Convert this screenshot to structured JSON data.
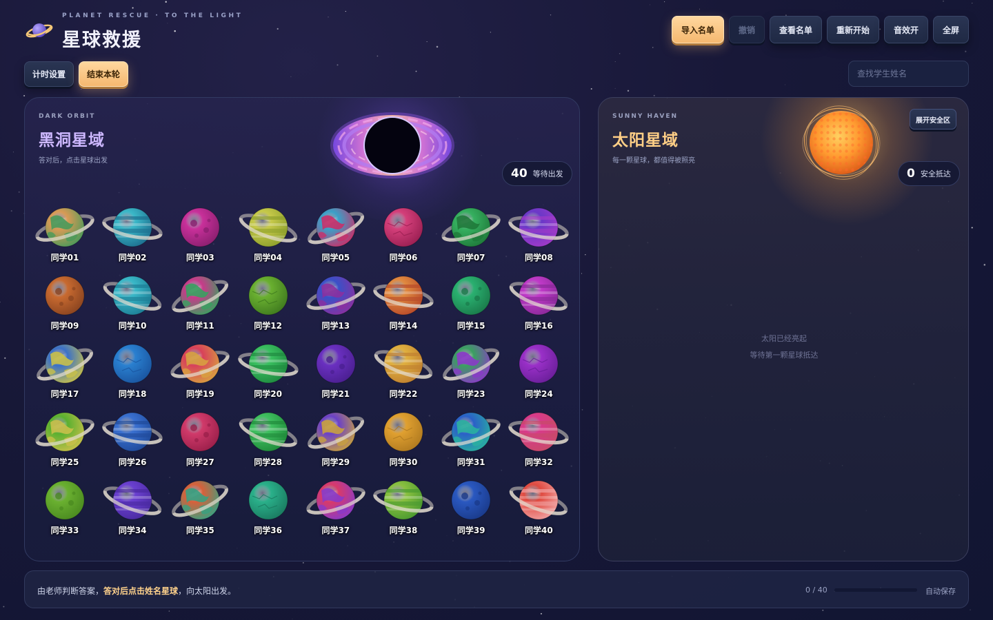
{
  "header": {
    "subtitle": "PLANET RESCUE · TO THE LIGHT",
    "title": "星球救援",
    "logo_icon": "ringed-planet-icon"
  },
  "toolbar": {
    "import_label": "导入名单",
    "undo_label": "撤销",
    "view_list_label": "查看名单",
    "restart_label": "重新开始",
    "sound_label": "音效开",
    "fullscreen_label": "全屏",
    "timer_label": "计时设置",
    "end_round_label": "结束本轮"
  },
  "search": {
    "placeholder": "查找学生姓名",
    "value": ""
  },
  "dark_zone": {
    "label_en": "DARK ORBIT",
    "title": "黑洞星域",
    "desc": "答对后，点击星球出发",
    "count": "40",
    "count_label": "等待出发",
    "icon": "black-hole-icon"
  },
  "sun_zone": {
    "label_en": "SUNNY HAVEN",
    "title": "太阳星域",
    "desc": "每一颗星球，都值得被照亮",
    "count": "0",
    "count_label": "安全抵达",
    "expand_label": "展开安全区",
    "empty_line1": "太阳已经亮起",
    "empty_line2": "等待第一颗星球抵达",
    "icon": "sun-icon"
  },
  "footer": {
    "msg_before": "由老师判断答案，",
    "msg_highlight": "答对后点击姓名星球",
    "msg_after": "，向太阳出发。",
    "progress_text": "0 / 40",
    "progress_value": 0,
    "autosave": "自动保存"
  },
  "colors": {
    "accent_gold": "#ffcf86",
    "accent_purple": "#cdb8ff",
    "background": "#181838"
  },
  "planets": [
    {
      "name": "同学01",
      "c1": "#d99a55",
      "c2": "#4a9a5a",
      "ring": true,
      "style": "patch"
    },
    {
      "name": "同学02",
      "c1": "#3bb8c8",
      "c2": "#1d6f8f",
      "ring": true,
      "style": "band"
    },
    {
      "name": "同学03",
      "c1": "#c8309a",
      "c2": "#8a1f6f",
      "ring": false,
      "style": "crater"
    },
    {
      "name": "同学04",
      "c1": "#c6c94a",
      "c2": "#8ea02c",
      "ring": true,
      "style": "band"
    },
    {
      "name": "同学05",
      "c1": "#3aa0c8",
      "c2": "#c8306a",
      "ring": true,
      "style": "patch"
    },
    {
      "name": "同学06",
      "c1": "#d43f7a",
      "c2": "#9a1f52",
      "ring": false,
      "style": "crack"
    },
    {
      "name": "同学07",
      "c1": "#36b060",
      "c2": "#1f7a3a",
      "ring": true,
      "style": "patch"
    },
    {
      "name": "同学08",
      "c1": "#6a38c8",
      "c2": "#a03ac8",
      "ring": true,
      "style": "band"
    },
    {
      "name": "同学09",
      "c1": "#c86a30",
      "c2": "#8a4420",
      "ring": false,
      "style": "crater"
    },
    {
      "name": "同学10",
      "c1": "#3ab8c8",
      "c2": "#1d7d95",
      "ring": true,
      "style": "band"
    },
    {
      "name": "同学11",
      "c1": "#c83a8a",
      "c2": "#3aa060",
      "ring": true,
      "style": "patch"
    },
    {
      "name": "同学12",
      "c1": "#6ab030",
      "c2": "#3f7a1f",
      "ring": false,
      "style": "crack"
    },
    {
      "name": "同学13",
      "c1": "#3a50c8",
      "c2": "#8a30a0",
      "ring": true,
      "style": "patch"
    },
    {
      "name": "同学14",
      "c1": "#e08a40",
      "c2": "#b84a2a",
      "ring": true,
      "style": "band"
    },
    {
      "name": "同学15",
      "c1": "#2ab070",
      "c2": "#1a7a4a",
      "ring": false,
      "style": "crater"
    },
    {
      "name": "同学16",
      "c1": "#c03ac8",
      "c2": "#8a2a9a",
      "ring": true,
      "style": "band"
    },
    {
      "name": "同学17",
      "c1": "#3a70c8",
      "c2": "#c8c04a",
      "ring": true,
      "style": "patch"
    },
    {
      "name": "同学18",
      "c1": "#2a80d0",
      "c2": "#1a55a0",
      "ring": false,
      "style": "crack"
    },
    {
      "name": "同学19",
      "c1": "#d8405a",
      "c2": "#d8a040",
      "ring": true,
      "style": "patch"
    },
    {
      "name": "同学20",
      "c1": "#3ac060",
      "c2": "#1f8a40",
      "ring": true,
      "style": "band"
    },
    {
      "name": "同学21",
      "c1": "#6a30c0",
      "c2": "#4a1f90",
      "ring": false,
      "style": "crater"
    },
    {
      "name": "同学22",
      "c1": "#e0b040",
      "c2": "#c08030",
      "ring": true,
      "style": "band"
    },
    {
      "name": "同学23",
      "c1": "#3aa060",
      "c2": "#8a3ac8",
      "ring": true,
      "style": "patch"
    },
    {
      "name": "同学24",
      "c1": "#9a30c8",
      "c2": "#6a1f9a",
      "ring": false,
      "style": "crack"
    },
    {
      "name": "同学25",
      "c1": "#5ab030",
      "c2": "#c8c04a",
      "ring": true,
      "style": "patch"
    },
    {
      "name": "同学26",
      "c1": "#3a70d0",
      "c2": "#1f4a9a",
      "ring": true,
      "style": "band"
    },
    {
      "name": "同学27",
      "c1": "#d03a6a",
      "c2": "#9a1f4a",
      "ring": false,
      "style": "crater"
    },
    {
      "name": "同学28",
      "c1": "#40c060",
      "c2": "#1f8a3a",
      "ring": true,
      "style": "band"
    },
    {
      "name": "同学29",
      "c1": "#6a40c8",
      "c2": "#c8a040",
      "ring": true,
      "style": "patch"
    },
    {
      "name": "同学30",
      "c1": "#e0a030",
      "c2": "#b07a20",
      "ring": false,
      "style": "crack"
    },
    {
      "name": "同学31",
      "c1": "#2a60c8",
      "c2": "#2ab0a0",
      "ring": true,
      "style": "patch"
    },
    {
      "name": "同学32",
      "c1": "#d83a8a",
      "c2": "#c84a6a",
      "ring": true,
      "style": "band"
    },
    {
      "name": "同学33",
      "c1": "#6ab030",
      "c2": "#4a8a20",
      "ring": false,
      "style": "crater"
    },
    {
      "name": "同学34",
      "c1": "#6a40d0",
      "c2": "#4a2aa0",
      "ring": true,
      "style": "band"
    },
    {
      "name": "同学35",
      "c1": "#d8603a",
      "c2": "#3aa080",
      "ring": true,
      "style": "patch"
    },
    {
      "name": "同学36",
      "c1": "#2ab08a",
      "c2": "#1a7a60",
      "ring": false,
      "style": "crack"
    },
    {
      "name": "同学37",
      "c1": "#d83a6a",
      "c2": "#8a3ac8",
      "ring": true,
      "style": "patch"
    },
    {
      "name": "同学38",
      "c1": "#8ac040",
      "c2": "#4a9a30",
      "ring": true,
      "style": "band"
    },
    {
      "name": "同学39",
      "c1": "#2a58c0",
      "c2": "#1a3a8a",
      "ring": false,
      "style": "crater"
    },
    {
      "name": "同学40",
      "c1": "#e04a40",
      "c2": "#f0a0a0",
      "ring": true,
      "style": "band"
    }
  ]
}
